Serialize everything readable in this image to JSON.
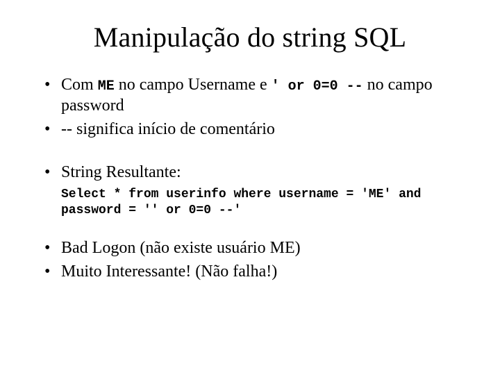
{
  "title": "Manipulação do string SQL",
  "bullets": {
    "b1": {
      "pre": "Com ",
      "code1": "ME",
      "mid1": " no campo Username e ",
      "code2": "' or 0=0 --",
      "post": " no campo password"
    },
    "b2": "-- significa início de comentário",
    "b3": "String Resultante:",
    "code_result": "Select * from userinfo where username = 'ME' and password = '' or 0=0 --'",
    "b4": "Bad Logon (não existe usuário ME)",
    "b5": "Muito Interessante! (Não falha!)"
  }
}
